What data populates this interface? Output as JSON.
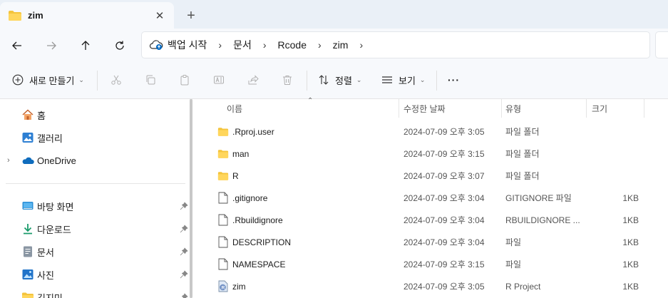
{
  "tab": {
    "title": "zim",
    "close_glyph": "✕",
    "new_tab_glyph": "+"
  },
  "nav": {
    "back_icon": "arrow-left-icon",
    "forward_icon": "arrow-right-icon",
    "up_icon": "arrow-up-icon",
    "refresh_icon": "refresh-icon"
  },
  "breadcrumb": {
    "items": [
      "백업 시작",
      "문서",
      "Rcode",
      "zim"
    ],
    "separator": "›"
  },
  "toolbar": {
    "new_label": "새로 만들기",
    "sort_label": "정렬",
    "view_label": "보기",
    "more_label": "···"
  },
  "sidebar": {
    "items": [
      {
        "label": "홈",
        "icon": "home-icon"
      },
      {
        "label": "갤러리",
        "icon": "gallery-icon"
      },
      {
        "label": "OneDrive",
        "icon": "onedrive-icon",
        "expander": "›"
      },
      {
        "label": "바탕 화면",
        "icon": "desktop-icon",
        "pinned": true
      },
      {
        "label": "다운로드",
        "icon": "download-icon",
        "pinned": true
      },
      {
        "label": "문서",
        "icon": "document-icon",
        "pinned": true
      },
      {
        "label": "사진",
        "icon": "pictures-icon",
        "pinned": true
      },
      {
        "label": "김지민",
        "icon": "folder-icon",
        "pinned": true
      }
    ]
  },
  "columns": {
    "name": "이름",
    "date": "수정한 날짜",
    "type": "유형",
    "size": "크기"
  },
  "files": [
    {
      "name": ".Rproj.user",
      "date": "2024-07-09 오후 3:05",
      "type": "파일 폴더",
      "size": "",
      "kind": "folder"
    },
    {
      "name": "man",
      "date": "2024-07-09 오후 3:15",
      "type": "파일 폴더",
      "size": "",
      "kind": "folder"
    },
    {
      "name": "R",
      "date": "2024-07-09 오후 3:07",
      "type": "파일 폴더",
      "size": "",
      "kind": "folder"
    },
    {
      "name": ".gitignore",
      "date": "2024-07-09 오후 3:04",
      "type": "GITIGNORE 파일",
      "size": "1KB",
      "kind": "file"
    },
    {
      "name": ".Rbuildignore",
      "date": "2024-07-09 오후 3:04",
      "type": "RBUILDIGNORE ...",
      "size": "1KB",
      "kind": "file"
    },
    {
      "name": "DESCRIPTION",
      "date": "2024-07-09 오후 3:04",
      "type": "파일",
      "size": "1KB",
      "kind": "file"
    },
    {
      "name": "NAMESPACE",
      "date": "2024-07-09 오후 3:15",
      "type": "파일",
      "size": "1KB",
      "kind": "file"
    },
    {
      "name": "zim",
      "date": "2024-07-09 오후 3:05",
      "type": "R Project",
      "size": "1KB",
      "kind": "rproj"
    }
  ],
  "colors": {
    "folder": "#f4c43c",
    "accent": "#0067c0",
    "tabstrip": "#eaf0f7"
  }
}
